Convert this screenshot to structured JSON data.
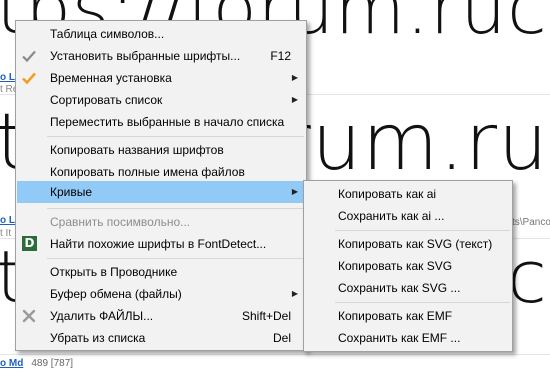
{
  "background": {
    "preview_text": "tps://forum.ruc",
    "rows": [
      {
        "font_name": "o Lt",
        "meta": "t Re"
      },
      {
        "font_name": "o Lt",
        "meta": "t It",
        "path_fragment": "ts\\Panco"
      },
      {
        "font_name": "o Md",
        "count": "489 [787]"
      }
    ]
  },
  "main_menu": {
    "items": [
      {
        "label": "Таблица символов..."
      },
      {
        "label": "Установить выбранные шрифты...",
        "shortcut": "F12",
        "icon": "check-gray-icon"
      },
      {
        "label": "Временная установка",
        "icon": "check-orange-icon",
        "submenu": true
      },
      {
        "label": "Сортировать список",
        "submenu": true
      },
      {
        "label": "Переместить выбранные в начало списка"
      },
      {
        "label": "Копировать названия шрифтов"
      },
      {
        "label": "Копировать полные имена файлов"
      },
      {
        "label": "Кривые",
        "submenu": true,
        "highlighted": true
      },
      {
        "label": "Сравнить посимвольно...",
        "disabled": true
      },
      {
        "label": "Найти похожие шрифты в FontDetect...",
        "icon": "fontdetect-icon",
        "icon_letter": "D"
      },
      {
        "label": "Открыть в Проводнике"
      },
      {
        "label": "Буфер обмена (файлы)",
        "submenu": true
      },
      {
        "label": "Удалить ФАЙЛЫ...",
        "shortcut": "Shift+Del",
        "icon": "delete-x-icon"
      },
      {
        "label": "Убрать из списка",
        "shortcut": "Del"
      }
    ]
  },
  "sub_menu": {
    "items": [
      {
        "label": "Копировать как ai"
      },
      {
        "label": "Сохранить как ai ..."
      },
      {
        "label": "Копировать как SVG (текст)"
      },
      {
        "label": "Копировать как SVG"
      },
      {
        "label": "Сохранить как SVG ..."
      },
      {
        "label": "Копировать как EMF"
      },
      {
        "label": "Сохранить как EMF ..."
      }
    ]
  },
  "colors": {
    "highlight": "#91c9f7",
    "menu_bg": "#f2f2f2",
    "check_orange": "#f0a020",
    "fontdetect_green": "#2d6b3b"
  }
}
